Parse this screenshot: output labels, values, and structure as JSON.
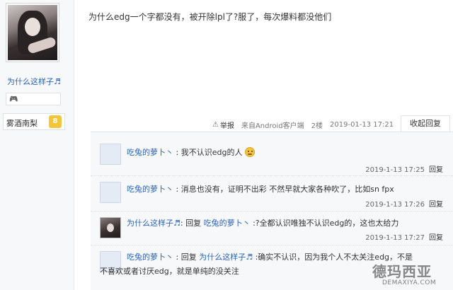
{
  "user": {
    "name": "为什么这样子♬",
    "badge_icon": "🎮",
    "level_name": "雾酒南梨",
    "level": "8"
  },
  "post": {
    "content": "为什么edg一个字都没有，被开除lpl了?服了，每次爆料都没他们",
    "report_label": "举报",
    "source": "来自Android客户端",
    "floor": "2楼",
    "time": "2019-01-13 17:21",
    "collapse_label": "收起回复"
  },
  "replies": [
    {
      "user": "吃兔的萝卜丶",
      "sep": ":",
      "text": "我不认识edg的人",
      "time": "2019-1-13 17:25",
      "reply_label": "回复"
    },
    {
      "user": "吃兔的萝卜丶",
      "sep": ":",
      "text": "消息也没有，证明不出彩 不然早就大家各种吹了，比如sn fpx",
      "time": "2019-1-13 17:26",
      "reply_label": "回复"
    },
    {
      "user": "为什么这样子♬",
      "sep": ":",
      "reply_word": "回复",
      "target": "吃兔的萝卜丶",
      "text": ":?全都认识唯独不认识edg的，这也太给力",
      "time": "2019-1-13 17:27",
      "reply_label": "回复"
    },
    {
      "user": "吃兔的萝卜丶",
      "sep": ":",
      "reply_word": "回复",
      "target": "为什么这样子♬",
      "text": ":确实不认识，因为我个人不太关注edg，不是",
      "text2": "不喜欢或者讨厌edg，就是单纯的没关注"
    }
  ],
  "watermark": {
    "main": "德玛西亚",
    "sub": "DEMAXIYA.COM"
  },
  "colors": {
    "link": "#2d64b3",
    "panel": "#f7f8fa",
    "level_badge": "#f3c53a"
  },
  "icons": {
    "warn": "warning-icon",
    "emoji": "emoji-icon",
    "badge": "game-badge-icon"
  }
}
